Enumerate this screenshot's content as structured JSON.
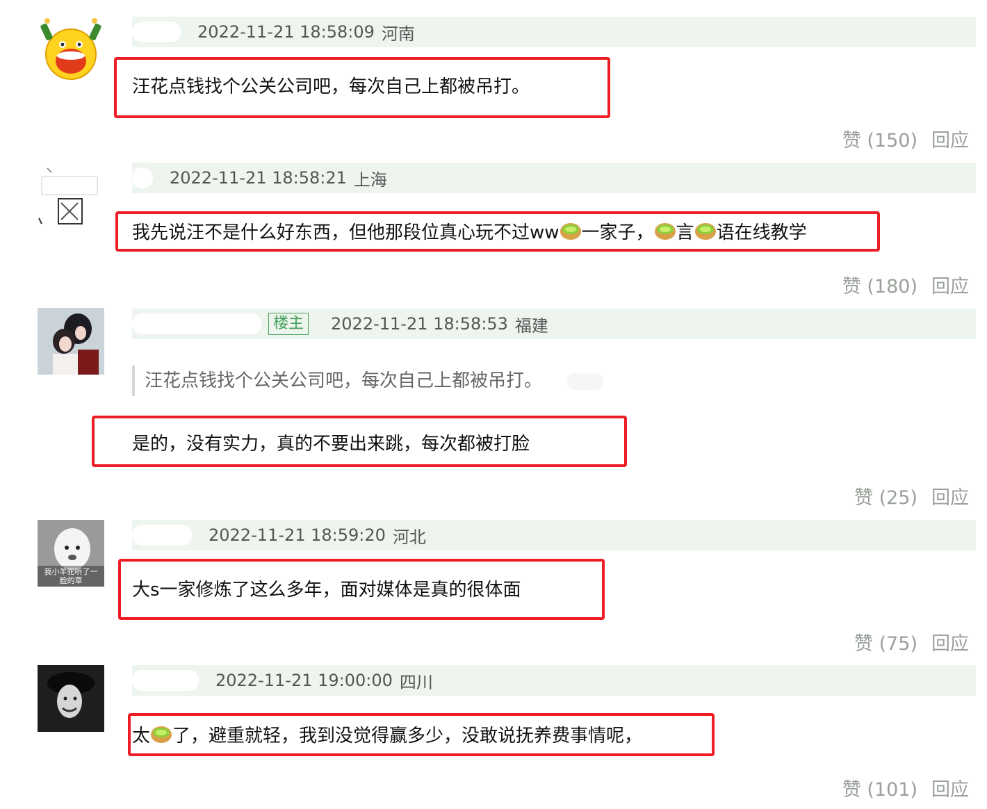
{
  "comments": [
    {
      "time": "2022-11-21 18:58:09",
      "location": "河南",
      "text": "汪花点钱找个公关公司吧，每次自己上都被吊打。",
      "like_label": "赞 (150)",
      "reply_label": "回应"
    },
    {
      "time": "2022-11-21 18:58:21",
      "location": "上海",
      "text_parts": [
        "我先说汪不是什么好东西，但他那段位真心玩不过ww",
        "一家子，",
        "言",
        "语在线教学"
      ],
      "like_label": "赞 (180)",
      "reply_label": "回应"
    },
    {
      "op_badge": "楼主",
      "time": "2022-11-21 18:58:53",
      "location": "福建",
      "quote": "汪花点钱找个公关公司吧，每次自己上都被吊打。",
      "text": "是的，没有实力，真的不要出来跳，每次都被打脸",
      "like_label": "赞 (25)",
      "reply_label": "回应"
    },
    {
      "time": "2022-11-21 18:59:20",
      "location": "河北",
      "avatar_caption": "我小羊驼听了一脸的草",
      "text": "大s一家修炼了这么多年，面对媒体是真的很体面",
      "like_label": "赞 (75)",
      "reply_label": "回应"
    },
    {
      "time": "2022-11-21 19:00:00",
      "location": "四川",
      "text_parts": [
        "太",
        "了，避重就轻，我到没觉得赢多少，没敢说抚养费事情呢，"
      ],
      "like_label": "赞 (101)",
      "reply_label": "回应"
    }
  ],
  "colors": {
    "meta_bg": "#eef4ee",
    "highlight": "#ee1c24",
    "op_badge": "#42a05a",
    "action_text": "#9aa09a"
  }
}
